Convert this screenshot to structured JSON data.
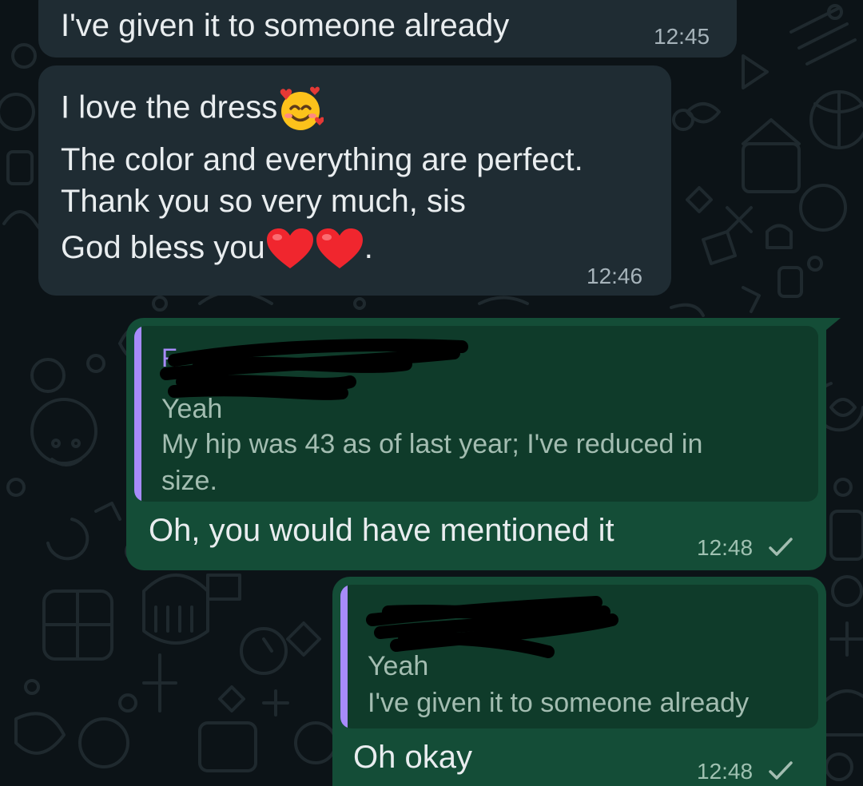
{
  "chat": {
    "messages": [
      {
        "direction": "incoming",
        "lines": [
          "I've given it to someone already"
        ],
        "time": "12:45"
      },
      {
        "direction": "incoming",
        "lines": [
          "I love the dress",
          "The color and everything are perfect.",
          "Thank you so very much, sis",
          "God bless you",
          "."
        ],
        "emojis": [
          "smiling-face-with-hearts-emoji",
          "red-heart-emoji",
          "red-heart-emoji"
        ],
        "time": "12:46"
      },
      {
        "direction": "outgoing",
        "quote": {
          "author": "F",
          "author_redacted": true,
          "lines": [
            "Yeah",
            "My hip was 43 as of last year; I've reduced in",
            "size."
          ]
        },
        "lines": [
          "Oh, you would have mentioned it"
        ],
        "time": "12:48",
        "status": "sent",
        "status_icon": "single-check-icon"
      },
      {
        "direction": "outgoing",
        "quote": {
          "author": "",
          "author_redacted": true,
          "lines": [
            "Yeah",
            "I've given it to someone already"
          ]
        },
        "lines": [
          "Oh okay"
        ],
        "time": "12:48",
        "status": "sent",
        "status_icon": "single-check-icon"
      }
    ]
  },
  "colors": {
    "background": "#0c1317",
    "incoming_bubble": "#1f2c33",
    "outgoing_bubble": "#144d37",
    "quote_bar": "#a78bfa",
    "message_text": "#e9edef"
  }
}
